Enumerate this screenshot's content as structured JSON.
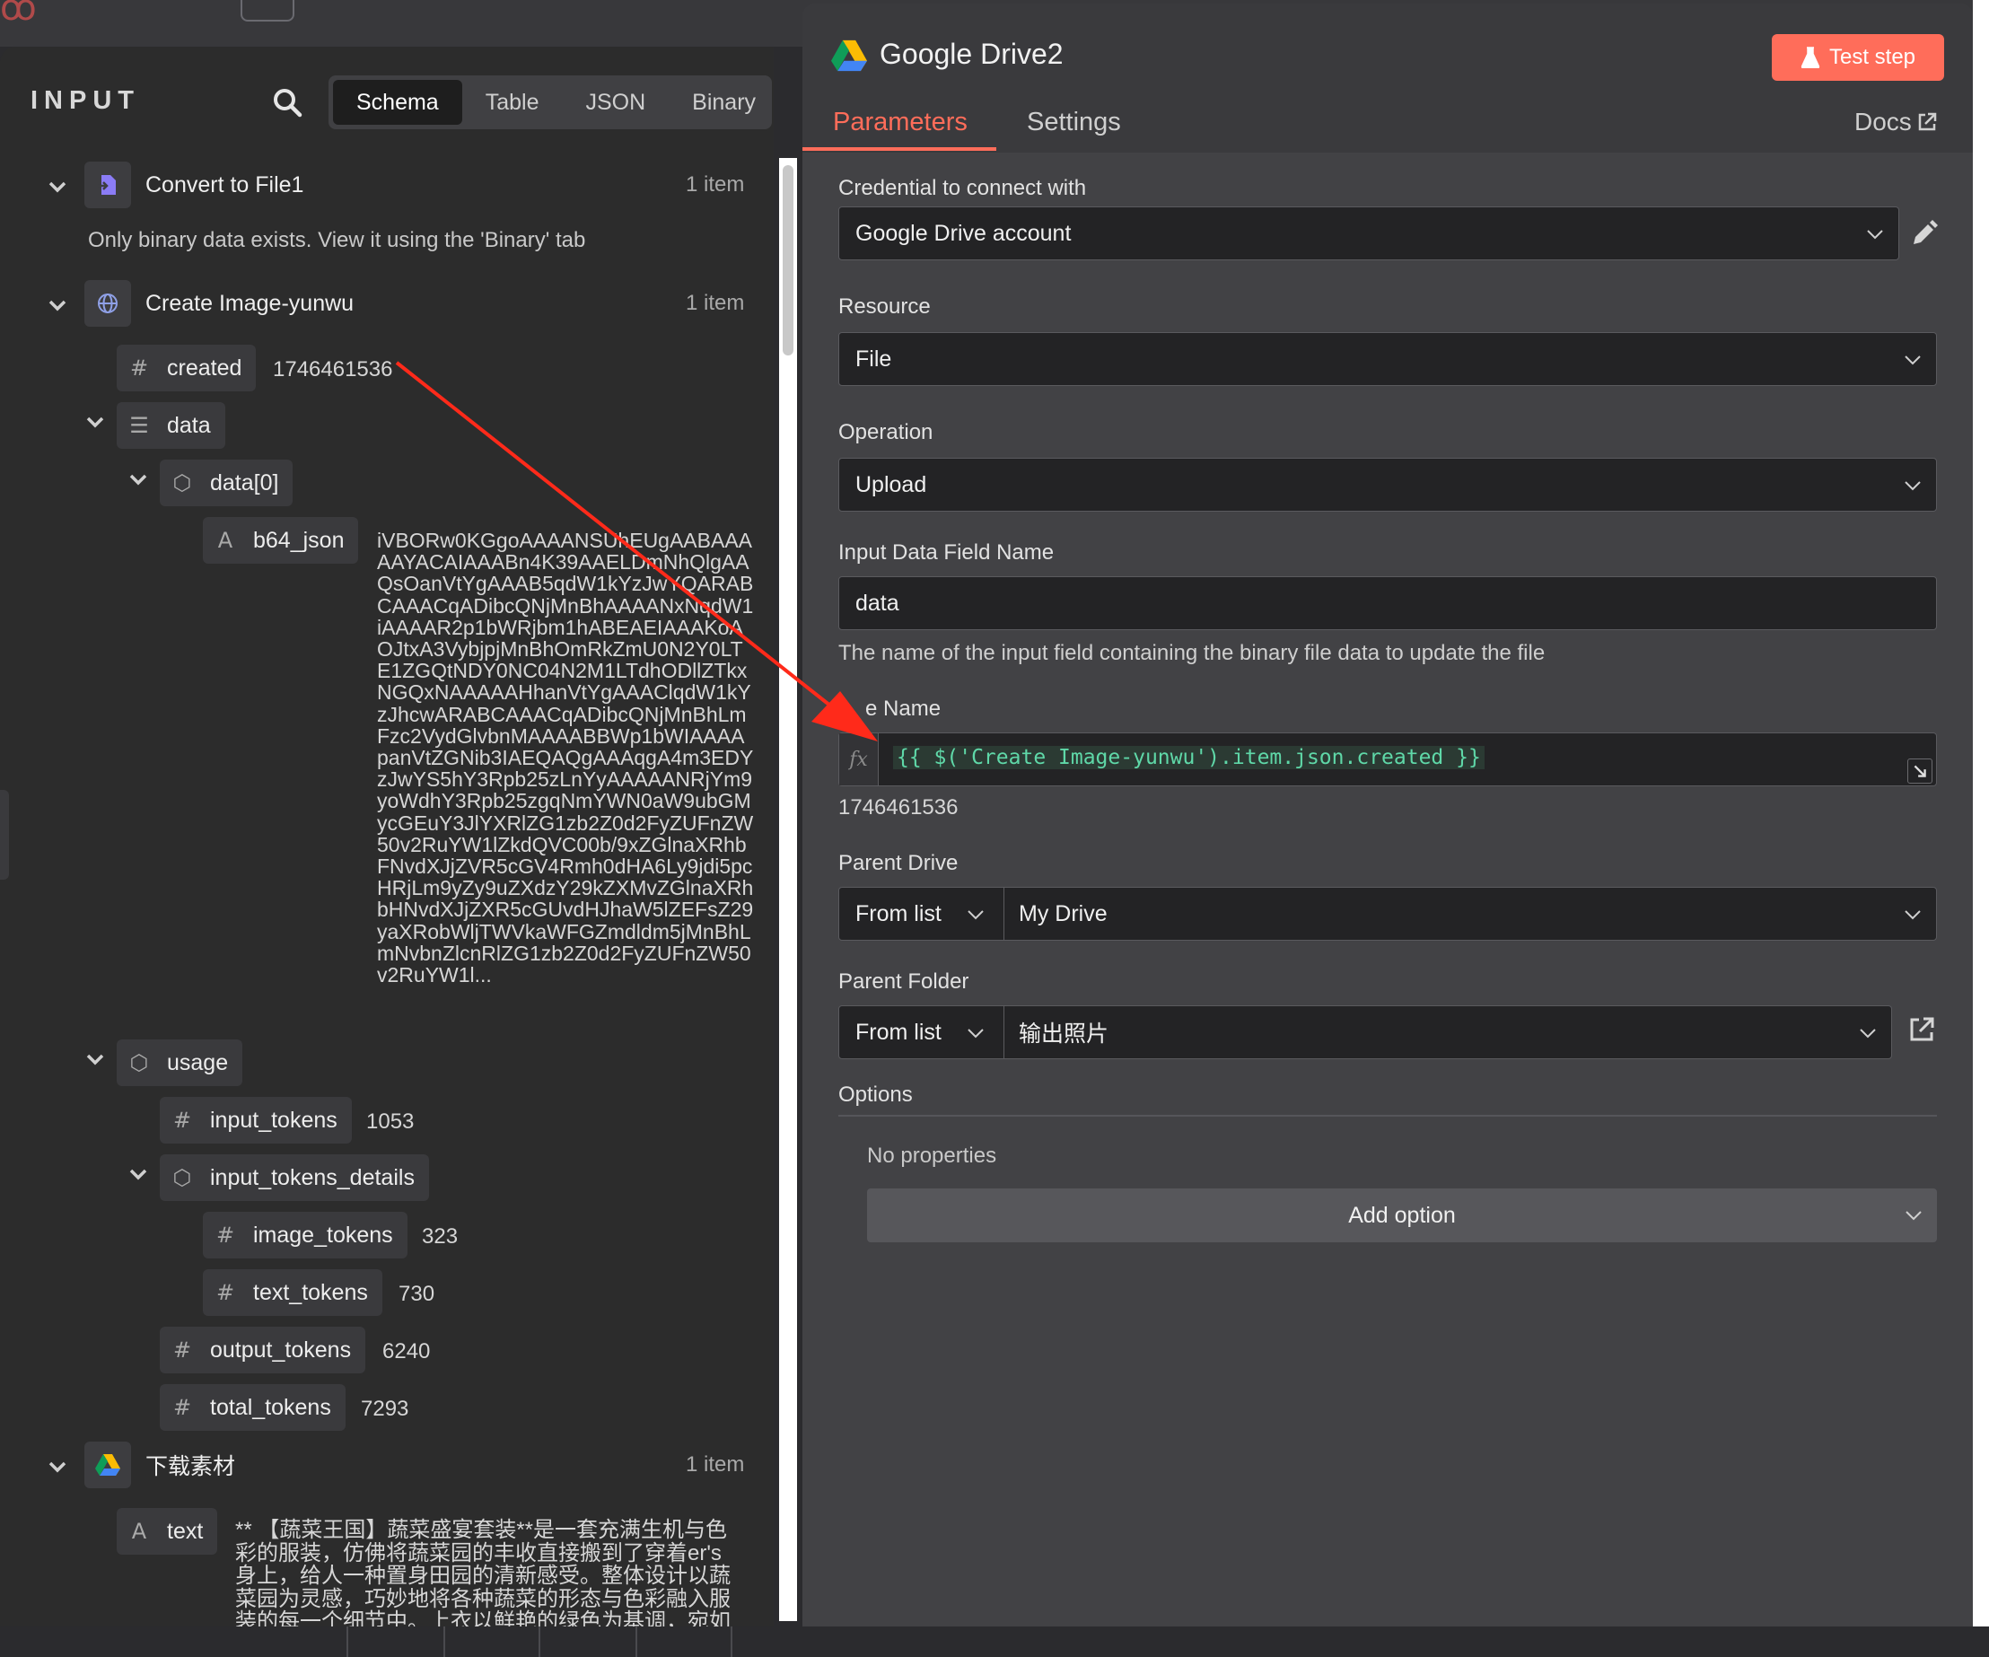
{
  "input_panel": {
    "title": "INPUT",
    "tabs": [
      "Schema",
      "Table",
      "JSON",
      "Binary"
    ],
    "active_tab": "Schema",
    "nodes": [
      {
        "name": "Convert to File1",
        "count": "1 item",
        "note": "Only binary data exists. View it using the 'Binary' tab"
      },
      {
        "name": "Create Image-yunwu",
        "count": "1 item"
      },
      {
        "name": "下载素材",
        "count": "1 item"
      }
    ],
    "fields": {
      "created_key": "created",
      "created_val": "1746461536",
      "data_key": "data",
      "data0_key": "data[0]",
      "b64_key": "b64_json",
      "b64_val": "iVBORw0KGgoAAAANSUhEUgAABAAAAAYACAIAAABn4K39AAELDmNhQlgAAQsOanVtYgAAAB5qdW1kYzJwYQARABCAAACqADibcQNjMnBhAAAANxNqdW1iAAAAR2p1bWRjbm1hABEAEIAAAKoAOJtxA3VybjpjMnBhOmRkZmU0N2Y0LTE1ZGQtNDY0NC04N2M1LTdhODllZTkxNGQxNAAAAAHhanVtYgAAAClqdW1kYzJhcwARABCAAACqADibcQNjMnBhLmFzc2VydGlvbnMAAAABBWp1bWIAAAApanVtZGNib3IAEQAQgAAAqgA4m3EDYzJwYS5hY3Rpb25zLnYyAAAAANRjYm9yoWdhY3Rpb25zgqNmYWN0aW9ubGMycGEuY3JlYXRlZG1zb2Z0d2FyZUFnZW50v2RuYW1lZkdQVC00b/9xZGlnaXRhbFNvdXJjZVR5cGV4Rmh0dHA6Ly9jdi5pcHRjLm9yZy9uZXdzY29kZXMvZGlnaXRhbHNvdXJjZXR5cGUvdHJhaW5lZEFsZ29yaXRobWljTWVkaWFGZmdldm5jMnBhLmNvbnZlcnRlZG1zb2Z0d2FyZUFnZW50v2RuYW1l...",
      "usage_key": "usage",
      "input_tokens_key": "input_tokens",
      "input_tokens_val": "1053",
      "input_tokens_details_key": "input_tokens_details",
      "image_tokens_key": "image_tokens",
      "image_tokens_val": "323",
      "text_tokens_key": "text_tokens",
      "text_tokens_val": "730",
      "output_tokens_key": "output_tokens",
      "output_tokens_val": "6240",
      "total_tokens_key": "total_tokens",
      "total_tokens_val": "7293",
      "text_key": "text",
      "text_val": "** 【蔬菜王国】蔬菜盛宴套装**是一套充满生机与色彩的服装，仿佛将蔬菜园的丰收直接搬到了穿着er's身上，给人一种置身田园的清新感受。整体设计以蔬菜园为灵感，巧妙地将各种蔬菜的形态与色彩融入服装的每一个细节中。上衣以鲜艳的绿色为基调，宛如"
    }
  },
  "node_panel": {
    "title": "Google Drive2",
    "test_button": "Test step",
    "tabs": {
      "parameters": "Parameters",
      "settings": "Settings",
      "docs": "Docs"
    },
    "credential_label": "Credential to connect with",
    "credential_value": "Google Drive account",
    "resource_label": "Resource",
    "resource_value": "File",
    "operation_label": "Operation",
    "operation_value": "Upload",
    "input_field_label": "Input Data Field Name",
    "input_field_value": "data",
    "input_field_hint": "The name of the input field containing the binary file data to update the file",
    "file_name_label": "e Name",
    "file_name_expr": "{{ $('Create Image-yunwu').item.json.created }}",
    "file_name_preview": "1746461536",
    "parent_drive_label": "Parent Drive",
    "parent_drive_mode": "From list",
    "parent_drive_value": "My Drive",
    "parent_folder_label": "Parent Folder",
    "parent_folder_mode": "From list",
    "parent_folder_value": "输出照片",
    "options_label": "Options",
    "no_properties": "No properties",
    "add_option": "Add option"
  },
  "colors": {
    "accent": "#ff6d5a",
    "arrow": "#ff2a1a",
    "expression": "#5fd8a8"
  }
}
